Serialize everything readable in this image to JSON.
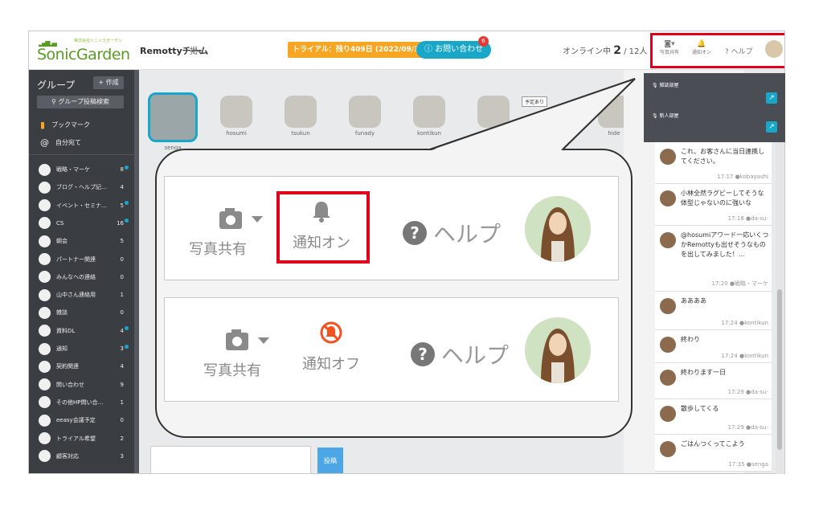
{
  "header": {
    "logo_small": "株式会社ソニックガーデン",
    "logo_main": "SonicGarden",
    "team_name": "Remottyチーム",
    "team_menu": "掲▾",
    "trial_text": "トライアル：残り409日 (2022/09/30迄)",
    "contact_label": "お問い合わせ",
    "contact_badge": "6",
    "online_label": "オンライン中",
    "online_count": "2",
    "online_total": "/ 12人",
    "photo_label": "写真共有",
    "notify_label": "通知オン",
    "help_label": "ヘルプ"
  },
  "sidebar": {
    "title": "グループ",
    "create_label": "+ 作成",
    "search_label": "グループ投稿検索",
    "bookmark_label": "ブックマーク",
    "mention_label": "自分宛て",
    "groups": [
      {
        "name": "戦略・マーケ",
        "count": "8",
        "dot": true
      },
      {
        "name": "ブログ・ヘルプ記…",
        "count": "4",
        "dot": false
      },
      {
        "name": "イベント・セミナ…",
        "count": "5",
        "dot": true
      },
      {
        "name": "CS",
        "count": "16",
        "dot": true
      },
      {
        "name": "朝会",
        "count": "5",
        "dot": false
      },
      {
        "name": "パートナー関連",
        "count": "0",
        "dot": false
      },
      {
        "name": "みんなへの連絡",
        "count": "0",
        "dot": false
      },
      {
        "name": "山中さん連絡用",
        "count": "1",
        "dot": false
      },
      {
        "name": "雑談",
        "count": "0",
        "dot": false
      },
      {
        "name": "資料DL",
        "count": "4",
        "dot": true
      },
      {
        "name": "通知",
        "count": "3",
        "dot": true
      },
      {
        "name": "契約関連",
        "count": "4",
        "dot": false
      },
      {
        "name": "問い合わせ",
        "count": "9",
        "dot": false
      },
      {
        "name": "その他HP問い合…",
        "count": "1",
        "dot": false
      },
      {
        "name": "eeasy会議予定",
        "count": "0",
        "dot": false
      },
      {
        "name": "トライアル希望",
        "count": "2",
        "dot": false
      },
      {
        "name": "顧客対応",
        "count": "3",
        "dot": false
      }
    ]
  },
  "members": [
    {
      "name": "senga"
    },
    {
      "name": "hosumi"
    },
    {
      "name": "tsukun"
    },
    {
      "name": "funady"
    },
    {
      "name": "kontikun"
    },
    {
      "name": ""
    },
    {
      "name": "hide"
    }
  ],
  "plan_tag": "予定あり",
  "post_button": "投稿",
  "voice_rooms": [
    {
      "name": "雑談部屋"
    },
    {
      "name": "新人部屋"
    }
  ],
  "messages": [
    {
      "text": "これ、お客さんに当日連携してください。",
      "time": "17:17",
      "user": "kobayashi"
    },
    {
      "text": "小林全然ラグビーしてそうな体型じゃないのに強いな",
      "time": "17:18",
      "user": "da-su-"
    },
    {
      "text": "@hosumiアワード一応いくつかRemottyも出せそうなものを出してみました！…",
      "time": "17:20",
      "user": "戦略・マーケ"
    },
    {
      "text": "ああああ",
      "time": "17:24",
      "user": "kontikun"
    },
    {
      "text": "終わり",
      "time": "17:24",
      "user": "kontikun"
    },
    {
      "text": "終わります一日",
      "time": "17:29",
      "user": "da-su-"
    },
    {
      "text": "散歩してくる",
      "time": "17:29",
      "user": "da-su-"
    },
    {
      "text": "ごはんつくってこよう",
      "time": "17:35",
      "user": "senga"
    }
  ],
  "zoom": {
    "photo_label": "写真共有",
    "notify_on_label": "通知オン",
    "notify_off_label": "通知オフ",
    "help_label": "ヘルプ"
  },
  "colors": {
    "accent": "#19a7c9",
    "highlight": "#e0001b",
    "trial": "#f6a623",
    "sidebar": "#3a3d42"
  }
}
